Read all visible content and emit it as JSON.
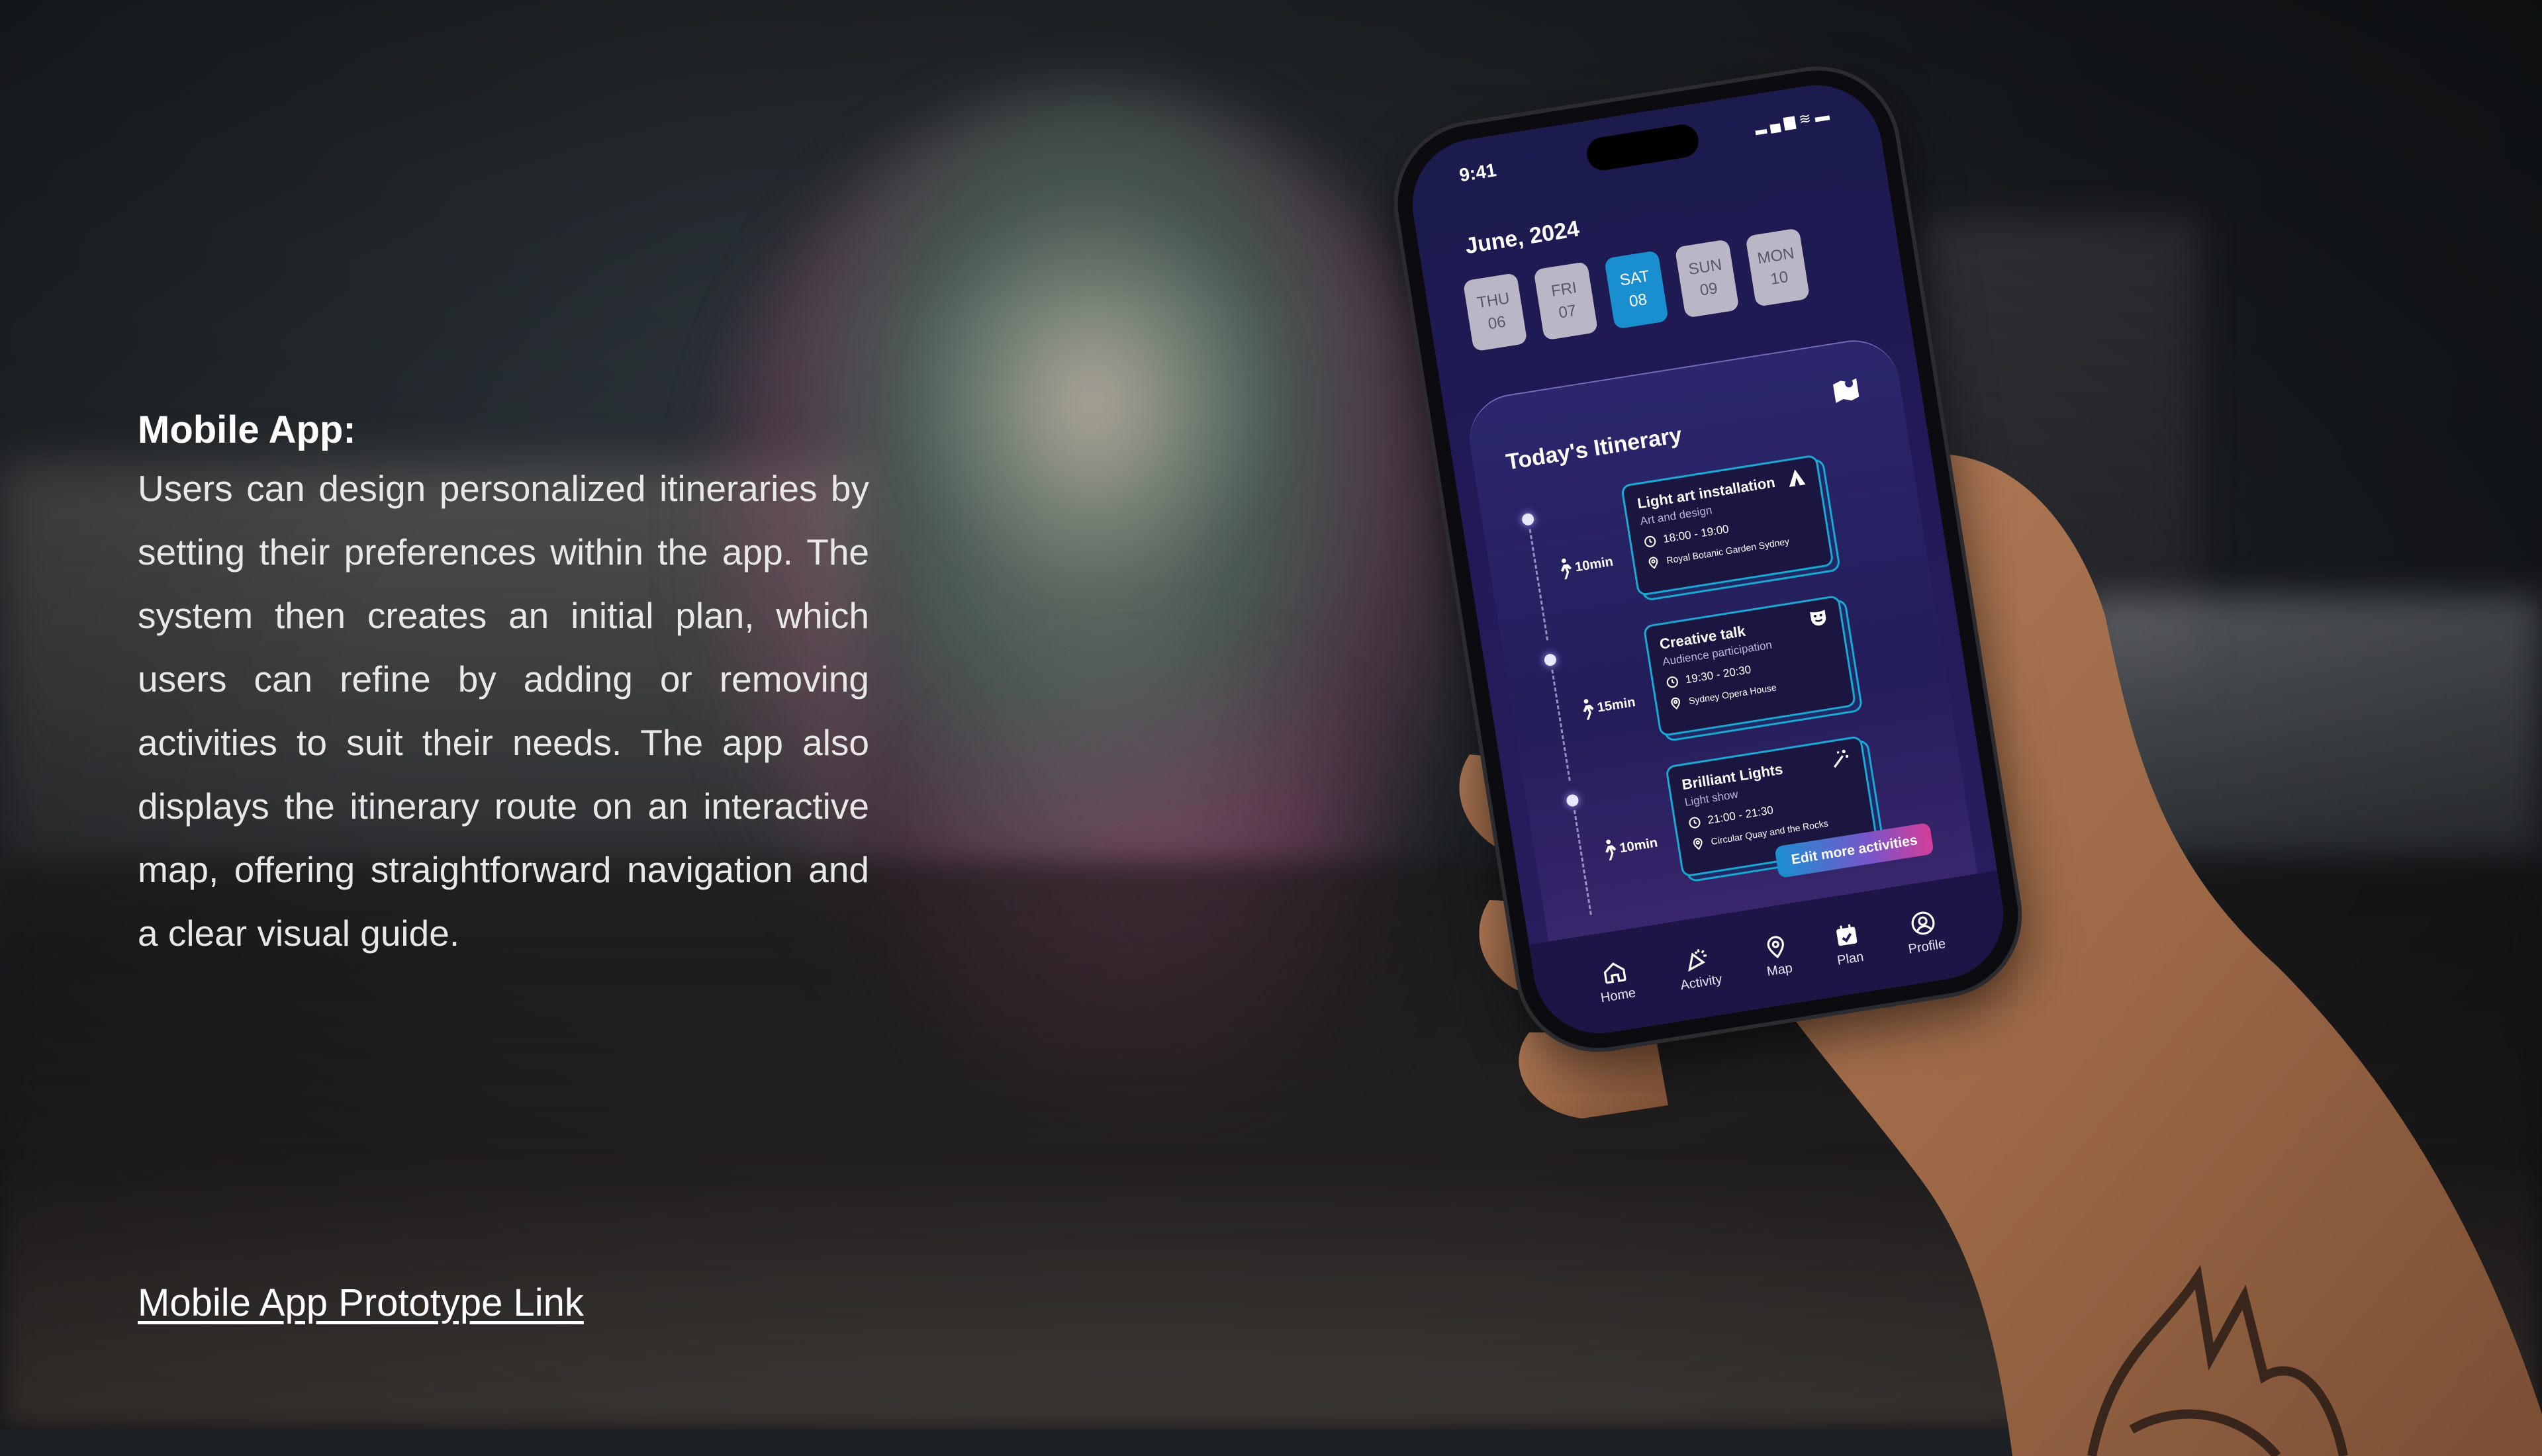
{
  "slide": {
    "heading": "Mobile App:",
    "body": "Users can design personalized itineraries by setting their preferences within the app. The system then creates an initial plan, which users can refine by adding or removing activities to suit their needs. The app also displays the itinerary route on an interactive map, offering straightforward navigation and a clear visual guide.",
    "link_label": "Mobile App Prototype Link"
  },
  "phone": {
    "status_time": "9:41",
    "status_icons": [
      "signal-icon",
      "wifi-icon",
      "battery-icon"
    ],
    "month": "June, 2024",
    "days": [
      {
        "dow": "THU",
        "num": "06",
        "active": false
      },
      {
        "dow": "FRI",
        "num": "07",
        "active": false
      },
      {
        "dow": "SAT",
        "num": "08",
        "active": true
      },
      {
        "dow": "SUN",
        "num": "09",
        "active": false
      },
      {
        "dow": "MON",
        "num": "10",
        "active": false
      }
    ],
    "itinerary_title": "Today's Itinerary",
    "items": [
      {
        "walk": "10min",
        "title": "Light art installation",
        "subtitle": "Art and design",
        "time": "18:00 - 19:00",
        "location": "Royal Botanic Garden Sydney",
        "icon": "tent-icon"
      },
      {
        "walk": "15min",
        "title": "Creative talk",
        "subtitle": "Audience participation",
        "time": "19:30 - 20:30",
        "location": "Sydney Opera House",
        "icon": "theater-mask-icon"
      },
      {
        "walk": "10min",
        "title": "Brilliant Lights",
        "subtitle": "Light show",
        "time": "21:00 - 21:30",
        "location": "Circular Quay and the Rocks",
        "icon": "sparkle-wand-icon"
      }
    ],
    "edit_button": "Edit more activities",
    "tabs": [
      {
        "label": "Home",
        "icon": "home-icon"
      },
      {
        "label": "Activity",
        "icon": "party-popper-icon"
      },
      {
        "label": "Map",
        "icon": "map-pin-icon"
      },
      {
        "label": "Plan",
        "icon": "calendar-check-icon"
      },
      {
        "label": "Profile",
        "icon": "user-circle-icon"
      }
    ]
  },
  "colors": {
    "accent": "#19a9d4",
    "active_day": "#1a8fd0",
    "button_gradient": [
      "#1b8fcf",
      "#7a55c9",
      "#d43d99"
    ],
    "screen_bg": "#221a58"
  }
}
